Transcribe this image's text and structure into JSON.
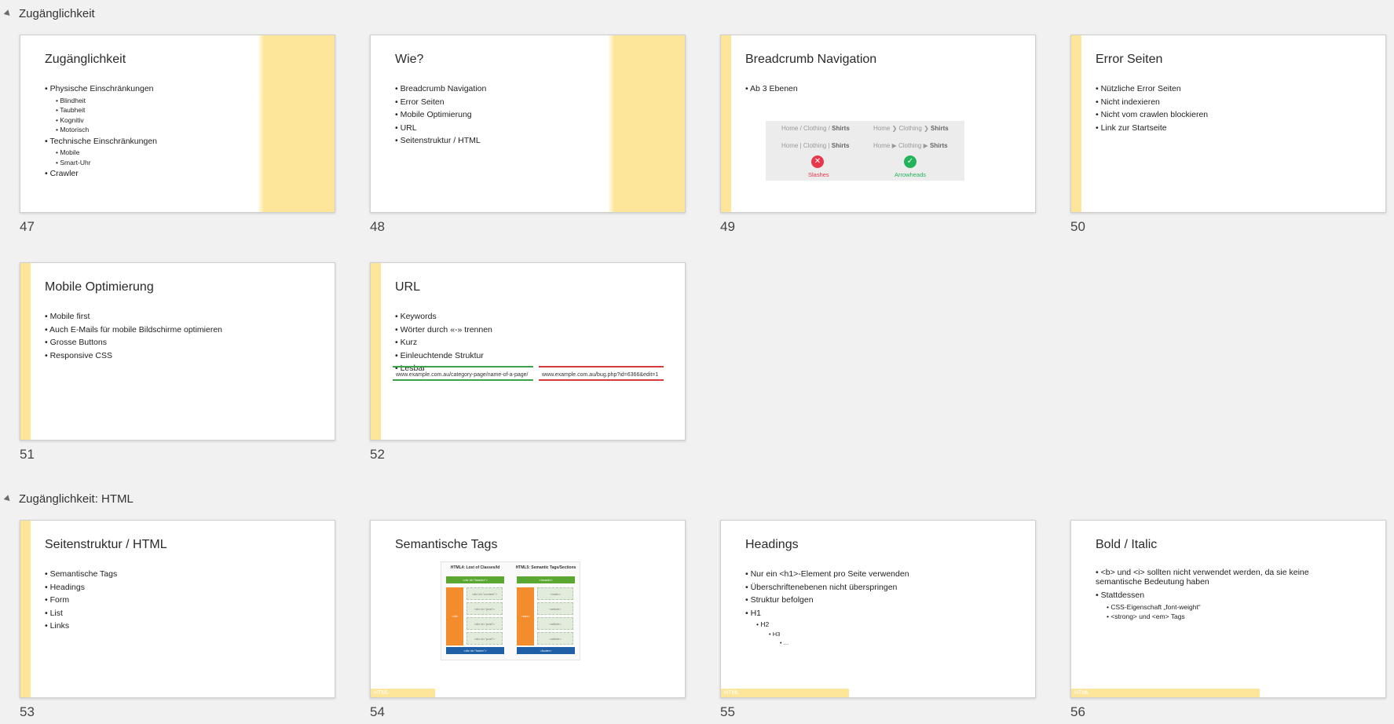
{
  "sections": [
    {
      "label": "Zugänglichkeit"
    },
    {
      "label": "Zugänglichkeit: HTML"
    }
  ],
  "slides": [
    {
      "number": "47",
      "title": "Zugänglichkeit",
      "bullets": [
        "Physische Einschränkungen",
        "Blindheit",
        "Taubheit",
        "Kognitiv",
        "Motorisch",
        "Technische Einschränkungen",
        "Mobile",
        "Smart-Uhr",
        "Crawler"
      ]
    },
    {
      "number": "48",
      "title": "Wie?",
      "bullets": [
        "Breadcrumb Navigation",
        "Error Seiten",
        "Mobile Optimierung",
        "URL",
        "Seitenstruktur / HTML"
      ]
    },
    {
      "number": "49",
      "title": "Breadcrumb Navigation",
      "bullets": [
        "Ab 3 Ebenen"
      ],
      "image": {
        "home": "Home",
        "clothing": "Clothing",
        "shirts": "Shirts",
        "sep_slash": "/",
        "sep_pipe": "|",
        "sep_chevron": "❯",
        "sep_arrow": "▶",
        "bad_caption": "Slashes",
        "good_caption": "Arrowheads",
        "bad_color": "#e8374a",
        "good_color": "#23b45a"
      }
    },
    {
      "number": "50",
      "title": "Error Seiten",
      "bullets": [
        "Nützliche Error Seiten",
        "Nicht indexieren",
        "Nicht vom crawlen blockieren",
        "Link zur Startseite"
      ]
    },
    {
      "number": "51",
      "title": "Mobile Optimierung",
      "bullets": [
        "Mobile first",
        "Auch E-Mails für mobile Bildschirme optimieren",
        "Grosse Buttons",
        "Responsive CSS"
      ]
    },
    {
      "number": "52",
      "title": "URL",
      "bullets": [
        "Keywords",
        "Wörter durch «-» trennen",
        "Kurz",
        "Einleuchtende Struktur",
        "Lesbar"
      ],
      "good_url": "www.example.com.au/category-page/name-of-a-page/",
      "bad_url": "www.example.com.au/bug.php?id=6366&edit=1"
    },
    {
      "number": "53",
      "title": "Seitenstruktur / HTML",
      "bullets": [
        "Semantische Tags",
        "Headings",
        "Form",
        "List",
        "Links"
      ]
    },
    {
      "number": "54",
      "title": "Semantische Tags",
      "footer": "HTML",
      "diagram": {
        "left_title": "HTML4: Lost of Classes/Id",
        "right_title": "HTML5: Semantic Tags/Sections",
        "left_header": "<div id=\"header\">",
        "left_nav": "<div id=\"navi\">",
        "left_box1": "<div id=\"content\">",
        "left_box2": "<div id=\"post\">",
        "left_box3": "<div id=\"post\">",
        "left_box4": "<div id=\"post\">",
        "left_footer": "<div id=\"footer\">",
        "right_header": "<header>",
        "right_nav": "<nav>",
        "right_box1": "<main>",
        "right_box2": "<article>",
        "right_box3": "<article>",
        "right_box4": "<article>",
        "right_footer": "<footer>"
      }
    },
    {
      "number": "55",
      "title": "Headings",
      "footer": "HTML",
      "bullets": [
        "Nur ein <h1>-Element pro Seite verwenden",
        "Überschriftenebenen nicht überspringen",
        "Struktur befolgen",
        "H1",
        "H2",
        "H3",
        "…"
      ]
    },
    {
      "number": "56",
      "title": "Bold / Italic",
      "footer": "HTML",
      "bullets": [
        "<b> und <i> sollten nicht verwendet werden, da sie keine semantische Bedeutung haben",
        "Stattdessen",
        "CSS-Eigenschaft „font-weight“",
        "<strong> und <em> Tags"
      ]
    }
  ]
}
